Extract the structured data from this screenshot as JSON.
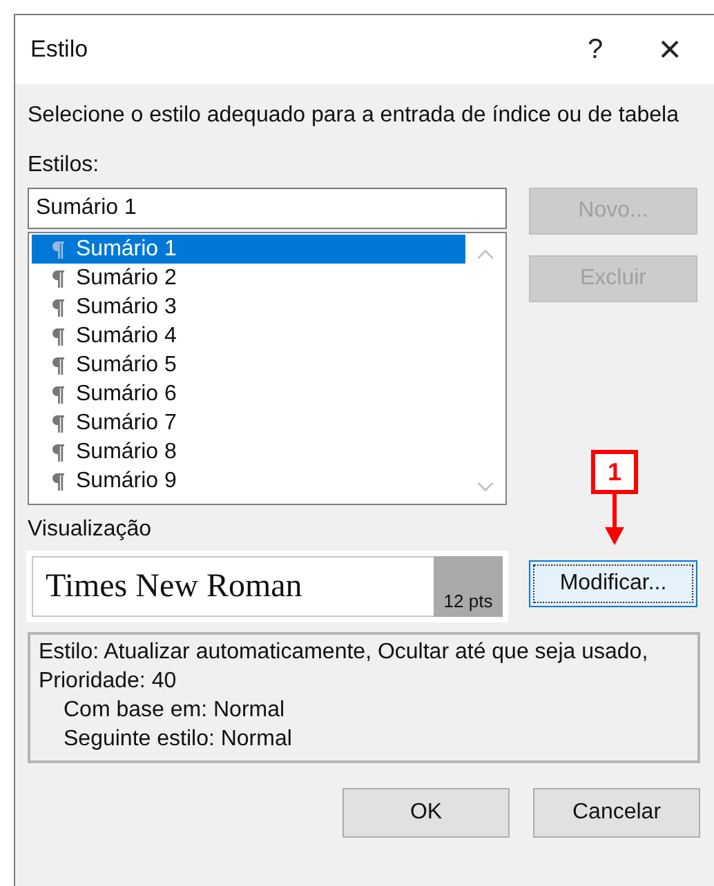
{
  "window": {
    "title": "Estilo",
    "help": "?",
    "close": "×"
  },
  "instruction": "Selecione o estilo adequado para a entrada de índice ou de tabela",
  "styles_label": "Estilos:",
  "style_field": {
    "value": "Sumário 1"
  },
  "style_list": [
    {
      "label": "Sumário 1",
      "selected": true
    },
    {
      "label": "Sumário 2",
      "selected": false
    },
    {
      "label": "Sumário 3",
      "selected": false
    },
    {
      "label": "Sumário 4",
      "selected": false
    },
    {
      "label": "Sumário 5",
      "selected": false
    },
    {
      "label": "Sumário 6",
      "selected": false
    },
    {
      "label": "Sumário 7",
      "selected": false
    },
    {
      "label": "Sumário 8",
      "selected": false
    },
    {
      "label": "Sumário 9",
      "selected": false
    }
  ],
  "side_buttons": [
    {
      "label": "Novo...",
      "disabled": true
    },
    {
      "label": "Excluir",
      "disabled": true
    }
  ],
  "callout": {
    "label": "1"
  },
  "modify_button": {
    "label": "Modificar...",
    "focused": true
  },
  "preview": {
    "label": "Visualização",
    "font_sample": "Times New Roman",
    "size": "12 pts"
  },
  "description": {
    "summary": "Estilo: Atualizar automaticamente, Ocultar até que seja usado, Prioridade: 40",
    "details": [
      "Com base em: Normal",
      "Seguinte estilo: Normal"
    ]
  },
  "buttons": [
    "OK",
    "Cancelar"
  ]
}
